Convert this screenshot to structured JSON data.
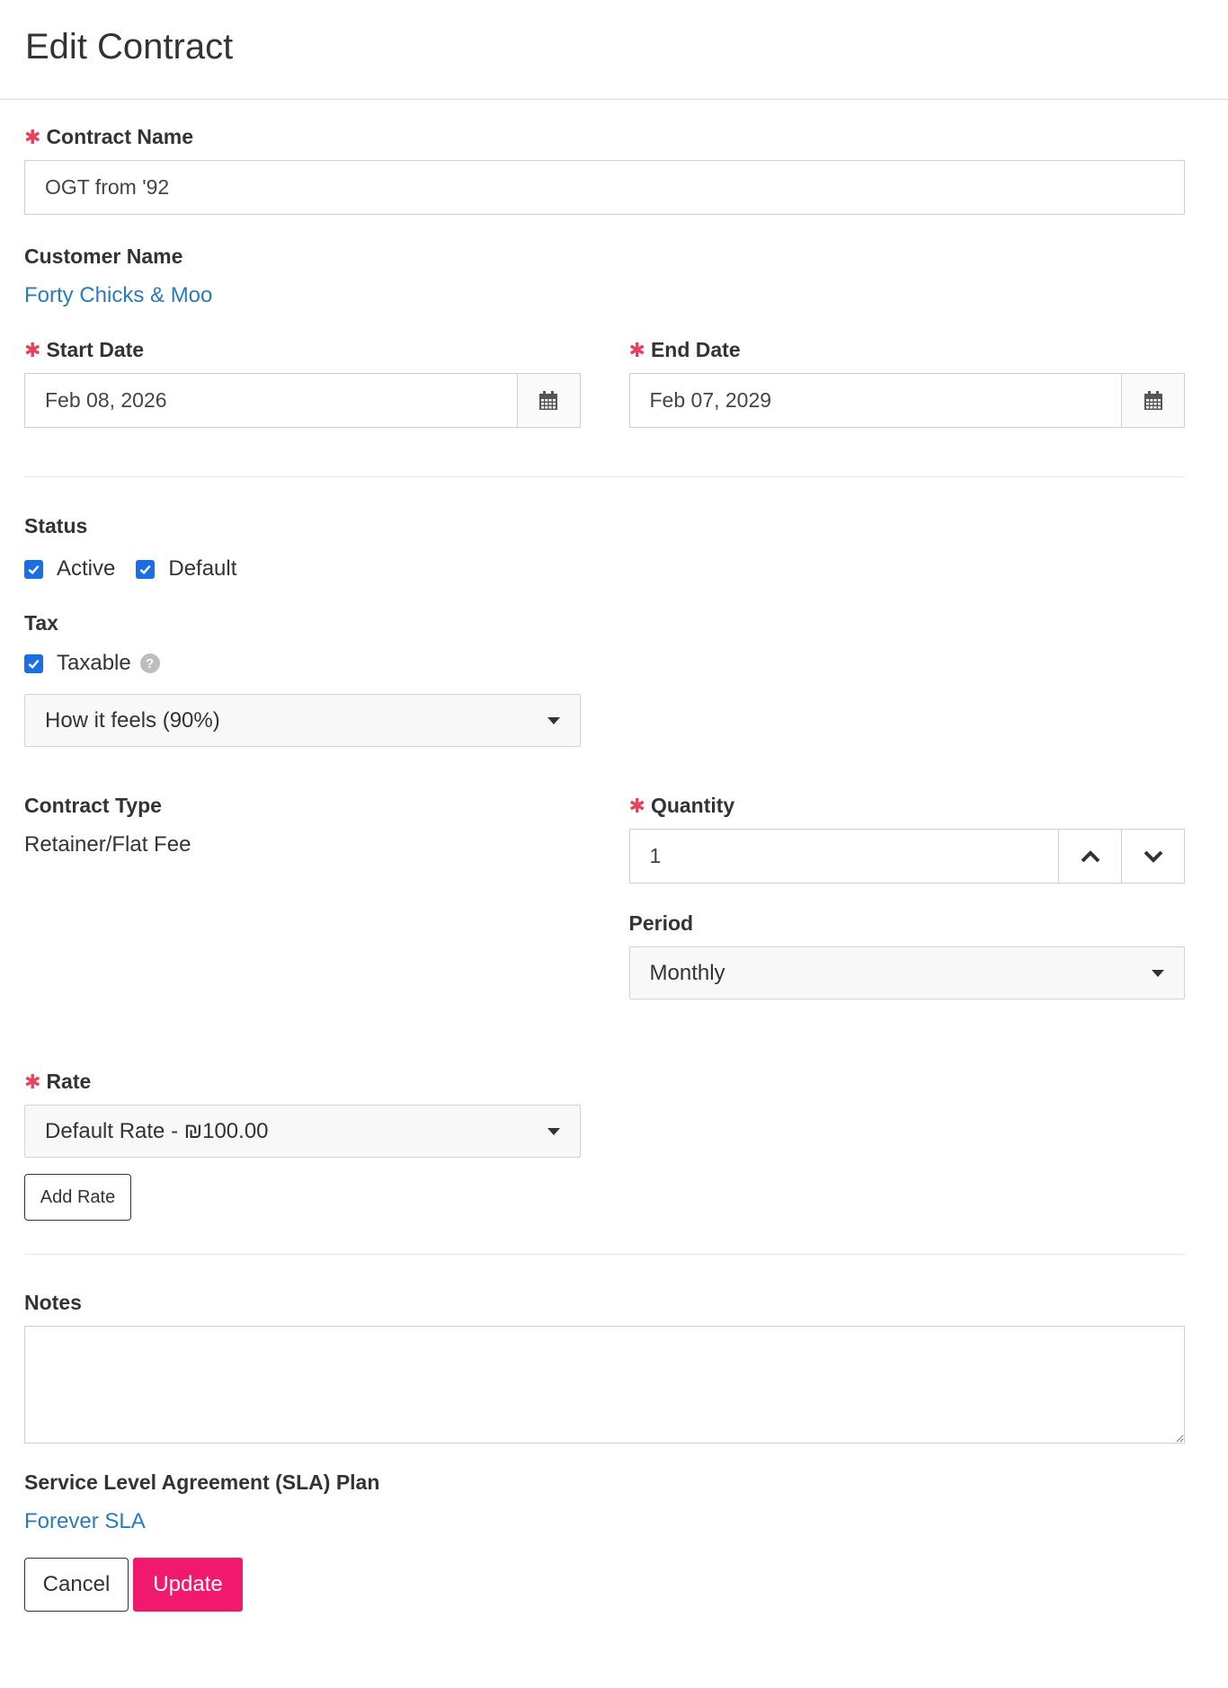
{
  "page": {
    "title": "Edit Contract"
  },
  "contract_name": {
    "label": "Contract Name",
    "value": "OGT from '92"
  },
  "customer": {
    "label": "Customer Name",
    "value": "Forty Chicks & Moo"
  },
  "start_date": {
    "label": "Start Date",
    "value": "Feb 08, 2026"
  },
  "end_date": {
    "label": "End Date",
    "value": "Feb 07, 2029"
  },
  "status": {
    "label": "Status",
    "active_label": "Active",
    "default_label": "Default"
  },
  "tax": {
    "label": "Tax",
    "taxable_label": "Taxable",
    "help_glyph": "?",
    "selected": "How it feels (90%)"
  },
  "contract_type": {
    "label": "Contract Type",
    "value": "Retainer/Flat Fee"
  },
  "quantity": {
    "label": "Quantity",
    "value": "1"
  },
  "period": {
    "label": "Period",
    "selected": "Monthly"
  },
  "rate": {
    "label": "Rate",
    "selected": "Default Rate - ₪100.00",
    "add_label": "Add Rate"
  },
  "notes": {
    "label": "Notes",
    "value": ""
  },
  "sla": {
    "label": "Service Level Agreement (SLA) Plan",
    "value": "Forever SLA"
  },
  "actions": {
    "cancel_label": "Cancel",
    "update_label": "Update"
  },
  "colors": {
    "accent": "#f0196d",
    "link": "#2b7bb9",
    "required": "#e8435a",
    "checkbox": "#1a6ee6"
  }
}
